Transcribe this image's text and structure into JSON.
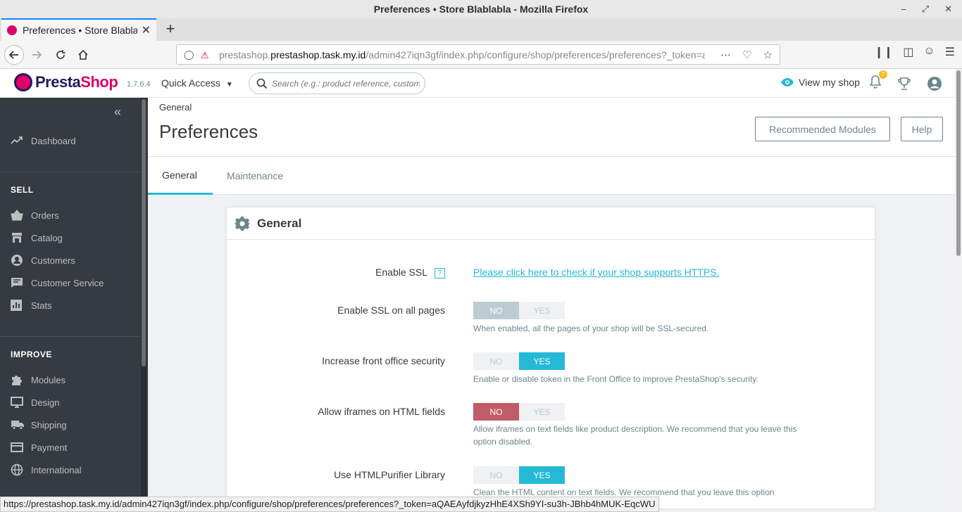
{
  "browser": {
    "window_title": "Preferences • Store Blablabla - Mozilla Firefox",
    "tab_title": "Preferences • Store Blablabla",
    "url_host": "prestashop.task.my.id",
    "url_prefix": "prestashop.",
    "url_path": "/admin427iqn3gf/index.php/configure/shop/preferences/preferences?_token=aQAEAyfdjk",
    "status_url": "https://prestashop.task.my.id/admin427iqn3gf/index.php/configure/shop/preferences/preferences?_token=aQAEAyfdjkyzHhE4XSh9YI-su3h-JBhb4hMUK-EqcWU"
  },
  "header": {
    "logo_text_a": "Presta",
    "logo_text_b": "Shop",
    "version": "1.7.6.4",
    "quick_access": "Quick Access",
    "search_placeholder": "Search (e.g.: product reference, customer",
    "view_shop": "View my shop",
    "notifications_count": "7"
  },
  "sidebar": {
    "dashboard": "Dashboard",
    "sell_title": "SELL",
    "sell_items": [
      "Orders",
      "Catalog",
      "Customers",
      "Customer Service",
      "Stats"
    ],
    "improve_title": "IMPROVE",
    "improve_items": [
      "Modules",
      "Design",
      "Shipping",
      "Payment",
      "International"
    ]
  },
  "page": {
    "breadcrumb": "General",
    "title": "Preferences",
    "recommended_modules": "Recommended Modules",
    "help": "Help",
    "tabs": [
      "General",
      "Maintenance"
    ]
  },
  "panel": {
    "title": "General",
    "switch_no": "NO",
    "switch_yes": "YES",
    "rows": [
      {
        "label": "Enable SSL",
        "help_icon": "?",
        "link": "Please click here to check if your shop supports HTTPS."
      },
      {
        "label": "Enable SSL on all pages",
        "value": "NO",
        "help": "When enabled, all the pages of your shop will be SSL-secured."
      },
      {
        "label": "Increase front office security",
        "value": "YES",
        "help": "Enable or disable token in the Front Office to improve PrestaShop's security."
      },
      {
        "label": "Allow iframes on HTML fields",
        "value": "NO",
        "help": "Allow iframes on text fields like product description. We recommend that you leave this option disabled."
      },
      {
        "label": "Use HTMLPurifier Library",
        "value": "YES",
        "help": "Clean the HTML content on text fields. We recommend that you leave this option"
      }
    ]
  },
  "colors": {
    "sidebar_bg": "#363a41",
    "accent": "#25b9d7",
    "danger": "#c05c67",
    "brand": "#df0067"
  }
}
